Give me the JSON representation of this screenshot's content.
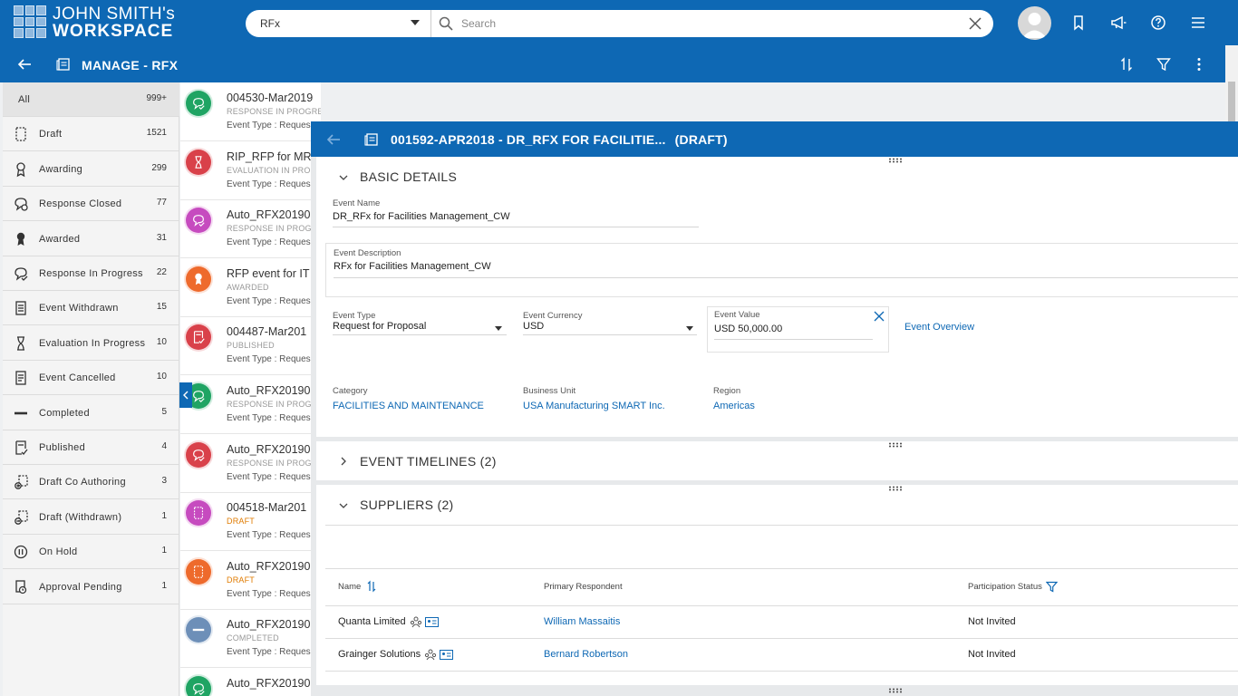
{
  "header": {
    "logo_line1": "JOHN SMITH's",
    "logo_line2": "WORKSPACE",
    "module_select": "RFx",
    "search_placeholder": "Search"
  },
  "subheader": {
    "title": "MANAGE - RFX"
  },
  "filters": [
    {
      "label": "All",
      "count": "999+",
      "icon": "none"
    },
    {
      "label": "Draft",
      "count": "1521",
      "icon": "dashed-doc-icon"
    },
    {
      "label": "Awarding",
      "count": "299",
      "icon": "ribbon-outline-icon"
    },
    {
      "label": "Response Closed",
      "count": "77",
      "icon": "chat-closed-icon"
    },
    {
      "label": "Awarded",
      "count": "31",
      "icon": "ribbon-filled-icon"
    },
    {
      "label": "Response In Progress",
      "count": "22",
      "icon": "chat-progress-icon"
    },
    {
      "label": "Event Withdrawn",
      "count": "15",
      "icon": "doc-withdrawn-icon"
    },
    {
      "label": "Evaluation In Progress",
      "count": "10",
      "icon": "hourglass-icon"
    },
    {
      "label": "Event Cancelled",
      "count": "10",
      "icon": "doc-cancelled-icon"
    },
    {
      "label": "Completed",
      "count": "5",
      "icon": "dash-icon"
    },
    {
      "label": "Published",
      "count": "4",
      "icon": "doc-published-icon"
    },
    {
      "label": "Draft Co Authoring",
      "count": "3",
      "icon": "co-author-icon"
    },
    {
      "label": "Draft (Withdrawn)",
      "count": "1",
      "icon": "draft-withdrawn-icon"
    },
    {
      "label": "On Hold",
      "count": "1",
      "icon": "pause-icon"
    },
    {
      "label": "Approval Pending",
      "count": "1",
      "icon": "approval-icon"
    }
  ],
  "events": [
    {
      "name": "004530-Mar2019",
      "status": "RESPONSE IN PROGRESS",
      "type": "Event Type : Reques",
      "color": "#1fa463",
      "icon": "chat-progress-icon",
      "status_color": "#999999"
    },
    {
      "name": "RIP_RFP for MR",
      "status": "EVALUATION IN PROG",
      "type": "Event Type : Reques",
      "color": "#d9414a",
      "icon": "hourglass-icon",
      "status_color": "#999999"
    },
    {
      "name": "Auto_RFX20190",
      "status": "RESPONSE IN PROG",
      "type": "Event Type : Reques",
      "color": "#c64bbf",
      "icon": "chat-progress-icon",
      "status_color": "#999999"
    },
    {
      "name": "RFP event for IT",
      "status": "AWARDED",
      "type": "Event Type : Reques",
      "color": "#ee6a2c",
      "icon": "ribbon-filled-icon",
      "status_color": "#999999"
    },
    {
      "name": "004487-Mar201",
      "status": "PUBLISHED",
      "type": "Event Type : Reques",
      "color": "#d9414a",
      "icon": "doc-published-icon",
      "status_color": "#999999"
    },
    {
      "name": "Auto_RFX20190",
      "status": "RESPONSE IN PROG",
      "type": "Event Type : Reques",
      "color": "#1fa463",
      "icon": "chat-progress-icon",
      "status_color": "#999999"
    },
    {
      "name": "Auto_RFX20190",
      "status": "RESPONSE IN PROG",
      "type": "Event Type : Reques",
      "color": "#d9414a",
      "icon": "chat-progress-icon",
      "status_color": "#999999"
    },
    {
      "name": "004518-Mar201",
      "status": "DRAFT",
      "type": "Event Type : Reques",
      "color": "#c64bbf",
      "icon": "dashed-doc-icon",
      "status_color": "#e07b00"
    },
    {
      "name": "Auto_RFX20190",
      "status": "DRAFT",
      "type": "Event Type : Reques",
      "color": "#ee6a2c",
      "icon": "dashed-doc-icon",
      "status_color": "#e07b00"
    },
    {
      "name": "Auto_RFX20190",
      "status": "COMPLETED",
      "type": "Event Type : Reques",
      "color": "#6d8fb8",
      "icon": "dash-icon",
      "status_color": "#999999"
    },
    {
      "name": "Auto_RFX20190",
      "status": "",
      "type": "",
      "color": "#1fa463",
      "icon": "chat-progress-icon",
      "status_color": "#999999"
    }
  ],
  "detail": {
    "title": "001592-APR2018 - DR_RFX FOR FACILITIE...",
    "status": "(DRAFT)",
    "basic": {
      "heading": "BASIC DETAILS",
      "event_name_label": "Event Name",
      "event_name": "DR_RFx for Facilities Management_CW",
      "event_desc_label": "Event Description",
      "event_desc": "RFx for Facilities Management_CW",
      "event_type_label": "Event Type",
      "event_type": "Request for Proposal",
      "currency_label": "Event Currency",
      "currency": "USD",
      "value_label": "Event Value",
      "value": "USD 50,000.00",
      "overview_link": "Event Overview",
      "category_label": "Category",
      "category": "FACILITIES AND MAINTENANCE",
      "bu_label": "Business Unit",
      "bu": "USA Manufacturing SMART Inc.",
      "region_label": "Region",
      "region": "Americas"
    },
    "timelines": {
      "heading": "EVENT TIMELINES (2)"
    },
    "suppliers": {
      "heading": "SUPPLIERS (2)",
      "col_name": "Name",
      "col_respondent": "Primary Respondent",
      "col_status": "Participation Status",
      "rows": [
        {
          "name": "Quanta Limited",
          "respondent": "William Massaitis",
          "status": "Not Invited"
        },
        {
          "name": "Grainger Solutions",
          "respondent": "Bernard Robertson",
          "status": "Not Invited"
        }
      ]
    }
  },
  "colors": {
    "brand": "#0e68b4",
    "link": "#0e68b4",
    "draft": "#e07b00"
  }
}
